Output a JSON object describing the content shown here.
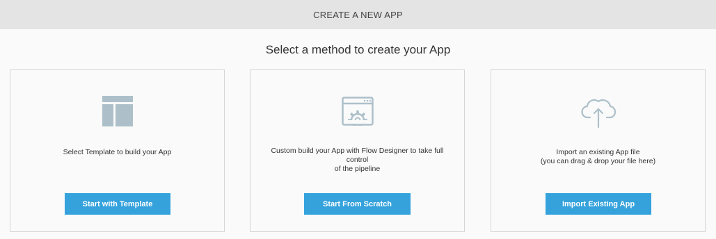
{
  "header": {
    "title": "CREATE A NEW APP"
  },
  "main": {
    "heading": "Select a method to create your App",
    "cards": [
      {
        "icon": "template-layout-icon",
        "description_lines": [
          "Select Template to build your App"
        ],
        "button_label": "Start with Template"
      },
      {
        "icon": "flow-designer-window-gear-icon",
        "description_lines": [
          "Custom build your App with Flow Designer to take full",
          "control",
          "of the pipeline"
        ],
        "button_label": "Start From Scratch"
      },
      {
        "icon": "cloud-upload-icon",
        "description_lines": [
          "Import an existing App file",
          "(you can drag & drop your file here)"
        ],
        "button_label": "Import Existing App"
      }
    ]
  },
  "colors": {
    "accent": "#35a2dc",
    "icon": "#adc0ca",
    "header_bg": "#e4e4e4",
    "card_border": "#d6d6d6"
  }
}
